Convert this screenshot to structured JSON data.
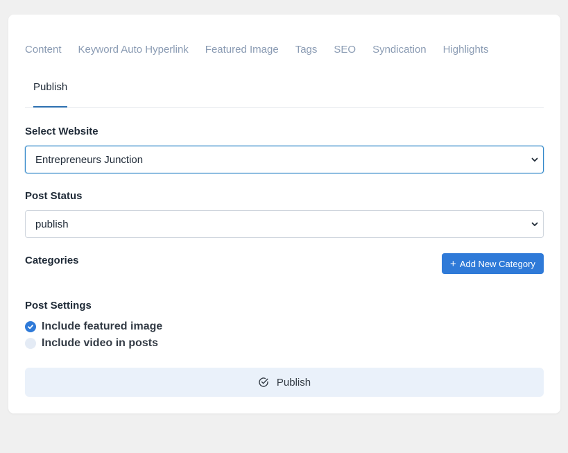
{
  "tabs": [
    "Content",
    "Keyword Auto Hyperlink",
    "Featured Image",
    "Tags",
    "SEO",
    "Syndication",
    "Highlights"
  ],
  "active_tab": "Publish",
  "select_website": {
    "label": "Select Website",
    "value": "Entrepreneurs Junction"
  },
  "post_status": {
    "label": "Post Status",
    "value": "publish"
  },
  "categories": {
    "label": "Categories",
    "add_button": "Add New Category",
    "add_icon": "plus-icon"
  },
  "post_settings": {
    "label": "Post Settings",
    "options": [
      {
        "label": "Include featured image",
        "checked": true
      },
      {
        "label": "Include video in posts",
        "checked": false
      }
    ]
  },
  "publish_button": {
    "label": "Publish",
    "icon": "check-circle-icon"
  },
  "colors": {
    "accent": "#2f7ad8",
    "tab_inactive": "#8a9bb3",
    "publish_bg": "#eaf1fa"
  }
}
